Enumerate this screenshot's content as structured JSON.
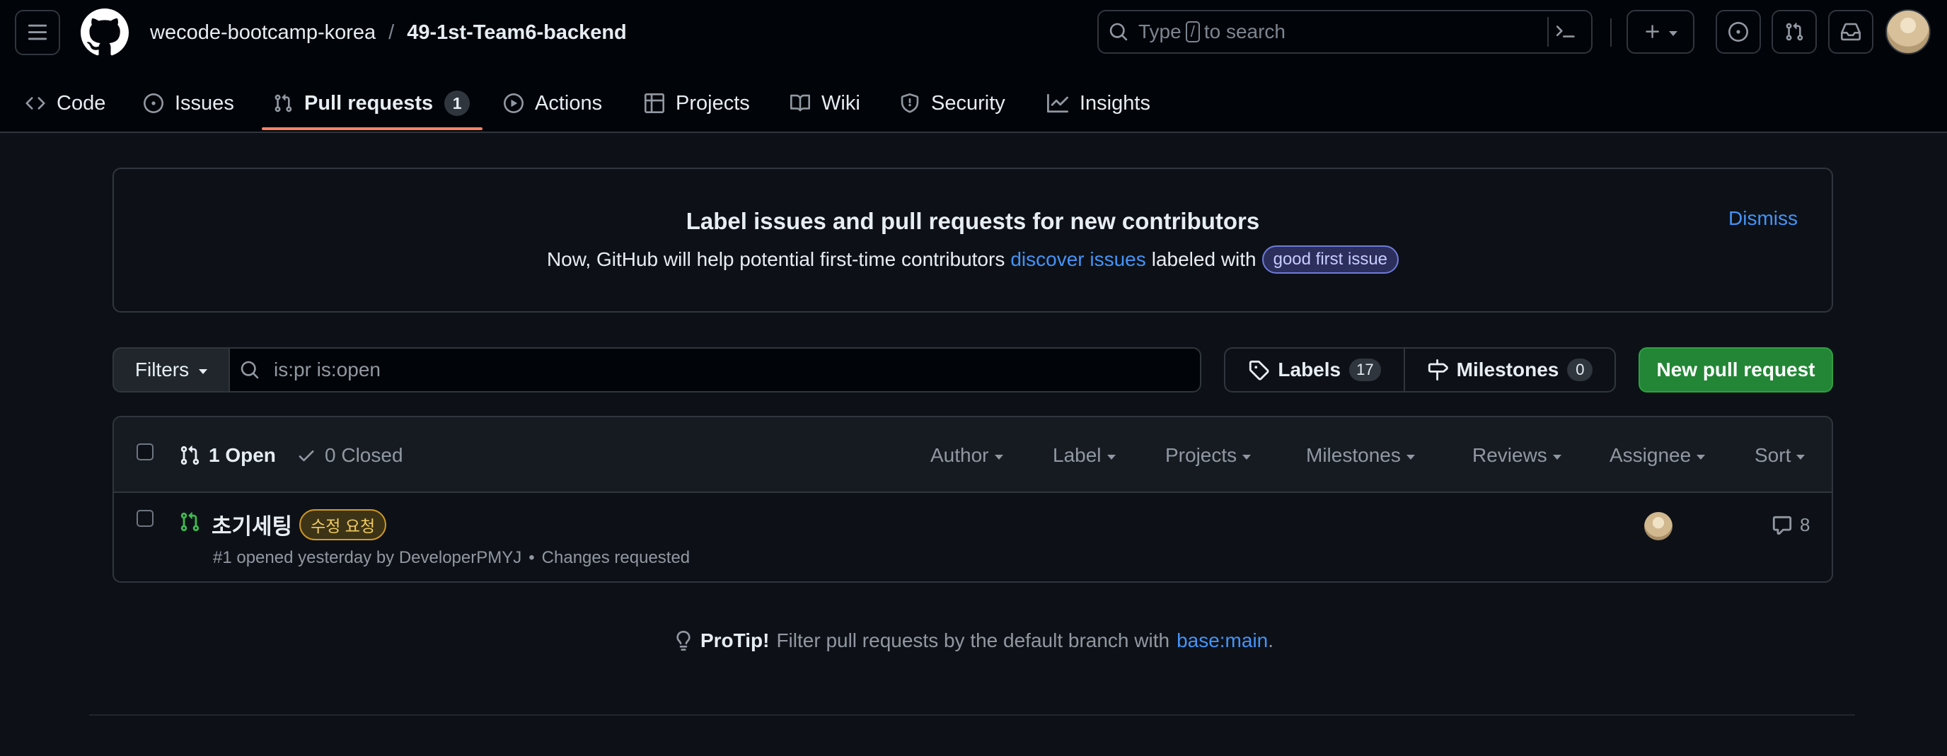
{
  "header": {
    "owner": "wecode-bootcamp-korea",
    "separator": "/",
    "repo": "49-1st-Team6-backend",
    "search": {
      "prefix": "Type",
      "key": "/",
      "suffix": "to search"
    }
  },
  "nav": {
    "tabs": [
      {
        "label": "Code",
        "icon": "code-icon"
      },
      {
        "label": "Issues",
        "icon": "issue-opened-icon"
      },
      {
        "label": "Pull requests",
        "icon": "git-pull-request-icon",
        "counter": "1",
        "active": true
      },
      {
        "label": "Actions",
        "icon": "play-icon"
      },
      {
        "label": "Projects",
        "icon": "table-icon"
      },
      {
        "label": "Wiki",
        "icon": "book-icon"
      },
      {
        "label": "Security",
        "icon": "shield-icon"
      },
      {
        "label": "Insights",
        "icon": "graph-icon"
      }
    ]
  },
  "banner": {
    "title": "Label issues and pull requests for new contributors",
    "text_before": "Now, GitHub will help potential first-time contributors",
    "link": "discover issues",
    "text_after": "labeled with",
    "label": "good first issue",
    "dismiss": "Dismiss"
  },
  "filter_bar": {
    "filters_label": "Filters",
    "query": "is:pr is:open",
    "labels_label": "Labels",
    "labels_count": "17",
    "milestones_label": "Milestones",
    "milestones_count": "0",
    "new_pr_label": "New pull request"
  },
  "list": {
    "open_label": "1 Open",
    "closed_label": "0 Closed",
    "filters": [
      "Author",
      "Label",
      "Projects",
      "Milestones",
      "Reviews",
      "Assignee",
      "Sort"
    ],
    "rows": [
      {
        "title": "초기세팅",
        "label": "수정 요청",
        "meta": "#1 opened yesterday by DeveloperPMYJ",
        "dot": "•",
        "status": "Changes requested",
        "comments": "8"
      }
    ]
  },
  "protip": {
    "bold": "ProTip!",
    "text": "Filter pull requests by the default branch with",
    "link": "base:main",
    "end": "."
  },
  "colors": {
    "background": "#0d1117",
    "accent_blue": "#4493f8",
    "success_green": "#238636",
    "open_pr_green": "#3fb950",
    "tab_underline": "#f78166"
  }
}
